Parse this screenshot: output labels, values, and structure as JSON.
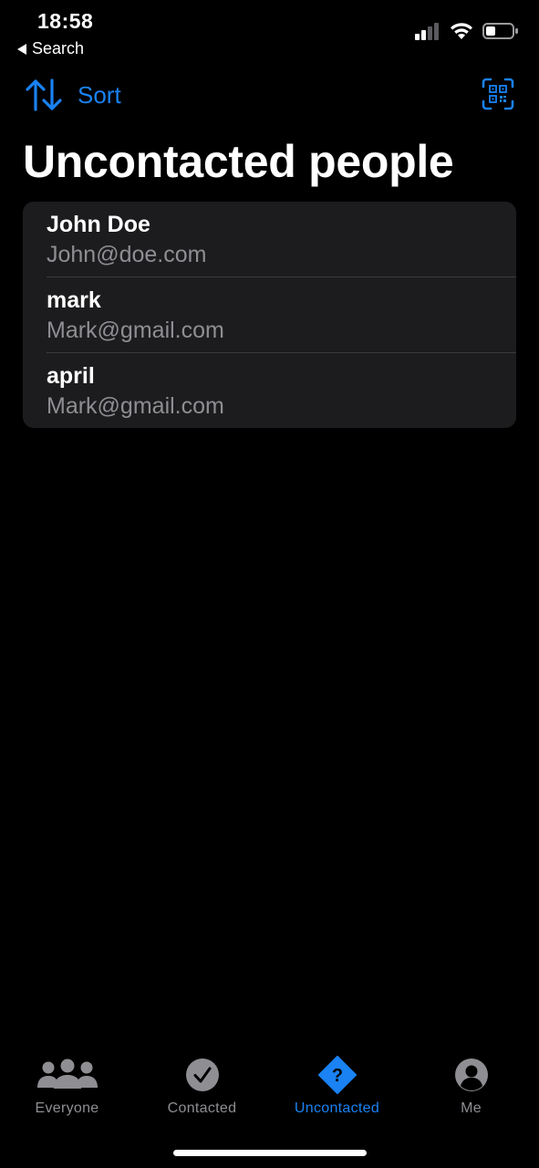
{
  "status_bar": {
    "time": "18:58",
    "back_label": "Search",
    "icons": [
      "cellular-signal-icon",
      "wifi-icon",
      "battery-icon"
    ]
  },
  "nav": {
    "sort_label": "Sort",
    "sort_icon": "sort-arrows-icon",
    "qr_icon": "qr-code-scanner-icon"
  },
  "page_title": "Uncontacted people",
  "people": [
    {
      "name": "John Doe",
      "email": "John@doe.com"
    },
    {
      "name": "mark",
      "email": "Mark@gmail.com"
    },
    {
      "name": "april",
      "email": "Mark@gmail.com"
    }
  ],
  "tabs": [
    {
      "label": "Everyone",
      "icon": "people-group-icon",
      "active": false
    },
    {
      "label": "Contacted",
      "icon": "checkmark-circle-icon",
      "active": false
    },
    {
      "label": "Uncontacted",
      "icon": "question-diamond-icon",
      "active": true
    },
    {
      "label": "Me",
      "icon": "person-circle-icon",
      "active": false
    }
  ],
  "colors": {
    "accent": "#1a82f2",
    "background": "#000000",
    "card": "#1c1c1e",
    "secondary_text": "#8e8e93",
    "inactive_icon": "#8e8e93"
  }
}
